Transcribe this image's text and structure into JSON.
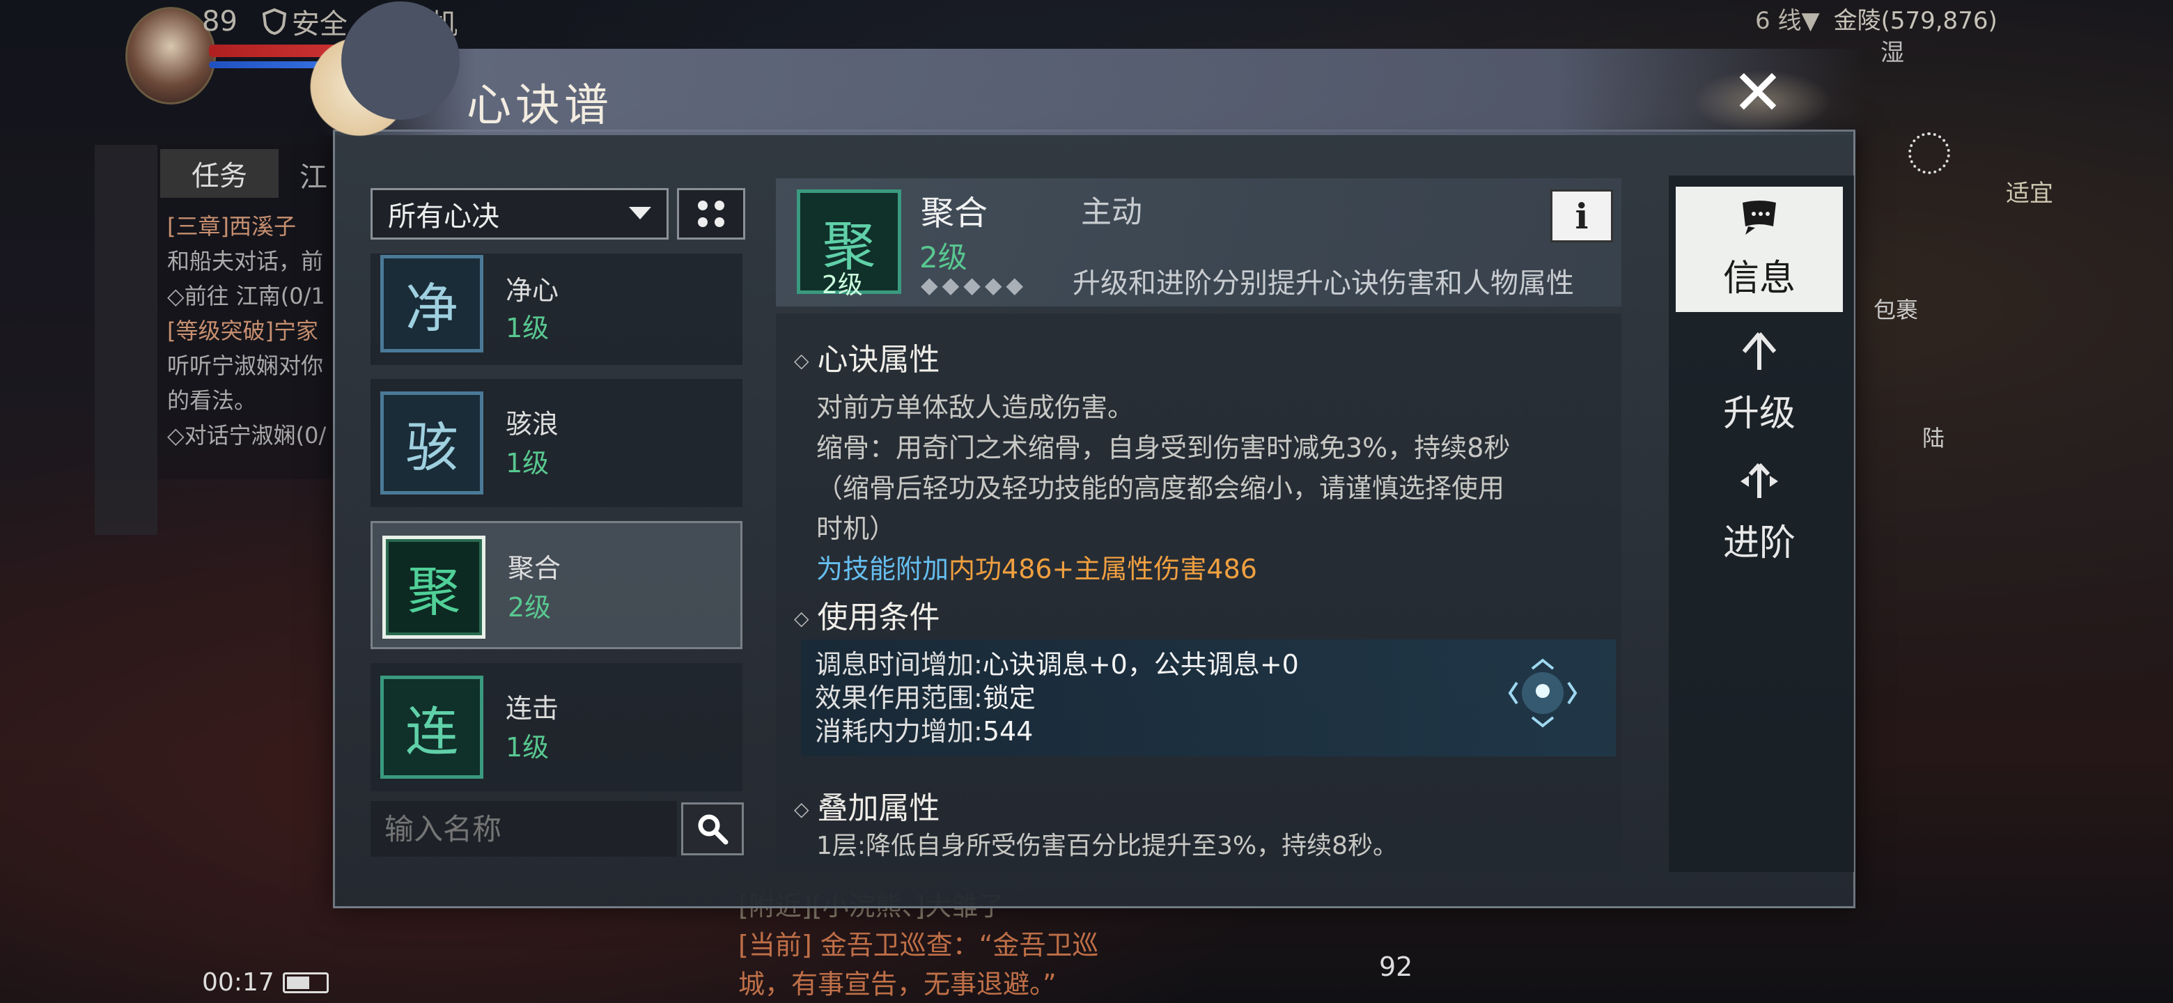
{
  "hud": {
    "player_level": "89",
    "safety": "安全",
    "auto": "挂机",
    "server_line": "6 线▼",
    "location": "金陵(579,876)",
    "weather": "湿",
    "suitable": "适宜",
    "tasks_tab": "任务",
    "tasks_tab2": "江",
    "task_lines": [
      "[三章]西溪子",
      "和船夫对话，前",
      "◇前往 江南(0/1",
      "[等级突破]宁家",
      "听听宁淑娴对你",
      "的看法。",
      "◇对话宁淑娴(0/"
    ],
    "chat_line1": "[附近][小浣熊、]大雏了",
    "chat_line2": "[当前] 金吾卫巡查：“金吾卫巡",
    "chat_line3": "城，有事宣告，无事退避。”",
    "time": "00:17",
    "count": "92",
    "pack": "包裹",
    "land": "陆"
  },
  "dialog": {
    "title": "心诀谱",
    "filter": {
      "selected": "所有心决"
    },
    "skills": [
      {
        "glyph": "净",
        "name": "净心",
        "level": "1级",
        "style": "blue"
      },
      {
        "glyph": "骇",
        "name": "骇浪",
        "level": "1级",
        "style": "blue"
      },
      {
        "glyph": "聚",
        "name": "聚合",
        "level": "2级",
        "style": "active"
      },
      {
        "glyph": "连",
        "name": "连击",
        "level": "1级",
        "style": "green"
      }
    ],
    "search": {
      "placeholder": "输入名称"
    },
    "detail": {
      "glyph": "聚",
      "icon_level": "2级",
      "name": "聚合",
      "type": "主动",
      "level": "2级",
      "diamonds": "◆◆◆◆◆",
      "desc": "升级和进阶分别提升心诀伤害和人物属性",
      "attr_title": "心诀属性",
      "attr_line1": "对前方单体敌人造成伤害。",
      "attr_line2": "缩骨：用奇门之术缩骨，自身受到伤害时减免3%，持续8秒",
      "attr_line3": "（缩骨后轻功及轻功技能的高度都会缩小，请谨慎选择使用",
      "attr_line4": "时机）",
      "bonus_prefix": "为技能附加",
      "bonus_value": "内功486+主属性伤害486",
      "cond_title": "使用条件",
      "cond1_key": "调息时间增加:",
      "cond1_val": "心诀调息+0，公共调息+0",
      "cond2_key": "效果作用范围:",
      "cond2_val": "锁定",
      "cond3_key": "消耗内力增加:",
      "cond3_val": "544",
      "stack_title": "叠加属性",
      "stack_line": "1层:降低自身所受伤害百分比提升至3%，持续8秒。"
    },
    "tabs": [
      {
        "label": "信息",
        "icon": "scroll-icon"
      },
      {
        "label": "升级",
        "icon": "arrow-up-icon"
      },
      {
        "label": "进阶",
        "icon": "advance-icon"
      }
    ]
  }
}
